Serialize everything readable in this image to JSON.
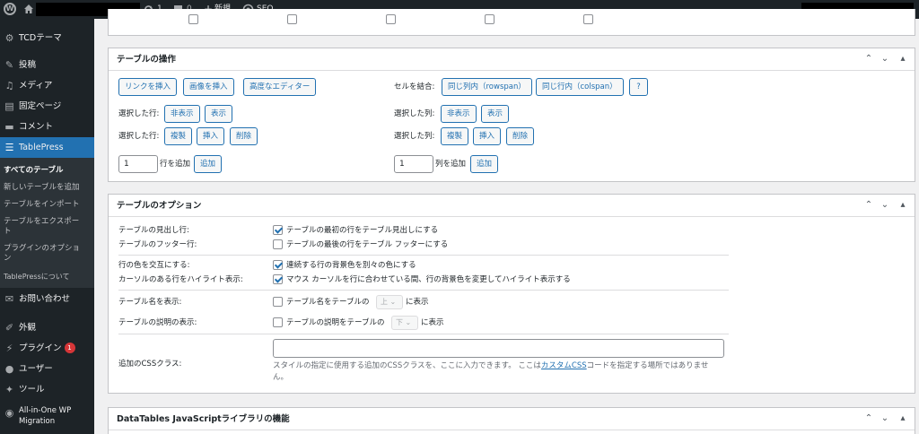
{
  "adminbar": {
    "updates_count": "1",
    "comments_count": "0",
    "new_label": "新規",
    "seo_label": "SEO"
  },
  "sidebar": {
    "items": [
      {
        "label": "TCDテーマ",
        "icon": "gear-icon"
      },
      {
        "label": "投稿",
        "icon": "pin-icon"
      },
      {
        "label": "メディア",
        "icon": "media-icon"
      },
      {
        "label": "固定ページ",
        "icon": "page-icon"
      },
      {
        "label": "コメント",
        "icon": "comment-icon"
      },
      {
        "label": "TablePress",
        "icon": "table-icon"
      }
    ],
    "submenu": [
      {
        "label": "すべてのテーブル"
      },
      {
        "label": "新しいテーブルを追加"
      },
      {
        "label": "テーブルをインポート"
      },
      {
        "label": "テーブルをエクスポー",
        "label2": "ト"
      },
      {
        "label": "プラグインのオプショ",
        "label2": "ン"
      },
      {
        "label": "TablePressについて"
      }
    ],
    "lower_items": [
      {
        "label": "お問い合わせ",
        "icon": "mail-icon"
      },
      {
        "label": "外観",
        "icon": "brush-icon"
      },
      {
        "label": "プラグイン",
        "icon": "plugin-icon",
        "badge": "1"
      },
      {
        "label": "ユーザー",
        "icon": "user-icon"
      },
      {
        "label": "ツール",
        "icon": "wrench-icon"
      },
      {
        "label": "All-in-One WP",
        "label2": "Migration",
        "icon": "migration-icon"
      }
    ]
  },
  "ops": {
    "title": "テーブルの操作",
    "insert_link": "リンクを挿入",
    "insert_image": "画像を挿入",
    "advanced_editor": "高度なエディター",
    "merge_label": "セルを結合:",
    "same_col": "同じ列内（rowspan）",
    "same_row": "同じ行内（colspan）",
    "help": "?",
    "sel_rows": "選択した行:",
    "sel_cols": "選択した列:",
    "hide": "非表示",
    "show": "表示",
    "dup": "複製",
    "insert": "挿入",
    "delete": "削除",
    "rows_value": "1",
    "rows_add_label": "行を追加",
    "cols_value": "1",
    "cols_add_label": "列を追加",
    "add": "追加"
  },
  "opts": {
    "title": "テーブルのオプション",
    "header_row": "テーブルの見出し行:",
    "header_row_desc": "テーブルの最初の行をテーブル見出しにする",
    "header_row_checked": true,
    "footer_row": "テーブルのフッター行:",
    "footer_row_desc": "テーブルの最後の行をテーブル フッターにする",
    "footer_row_checked": false,
    "alt_colors": "行の色を交互にする:",
    "alt_colors_desc": "連続する行の背景色を別々の色にする",
    "alt_colors_checked": true,
    "hover": "カーソルのある行をハイライト表示:",
    "hover_desc": "マウス カーソルを行に合わせている間、行の背景色を変更してハイライト表示する",
    "hover_checked": true,
    "show_name": "テーブル名を表示:",
    "show_name_pre": "テーブル名をテーブルの",
    "show_name_sel": "上",
    "show_name_post": "に表示",
    "show_name_checked": false,
    "show_desc": "テーブルの説明の表示:",
    "show_desc_pre": "テーブルの説明をテーブルの",
    "show_desc_sel": "下",
    "show_desc_post": "に表示",
    "show_desc_checked": false,
    "css_label": "追加のCSSクラス:",
    "css_value": "",
    "css_help_1": "スタイルの指定に使用する追加のCSSクラスを、ここに入力できます。 ここは",
    "css_help_link": "カスタムCSS",
    "css_help_2": "コードを指定する場所ではありませ",
    "css_help_3": "ん。"
  },
  "dt": {
    "title": "DataTables JavaScriptライブラリの機能"
  }
}
